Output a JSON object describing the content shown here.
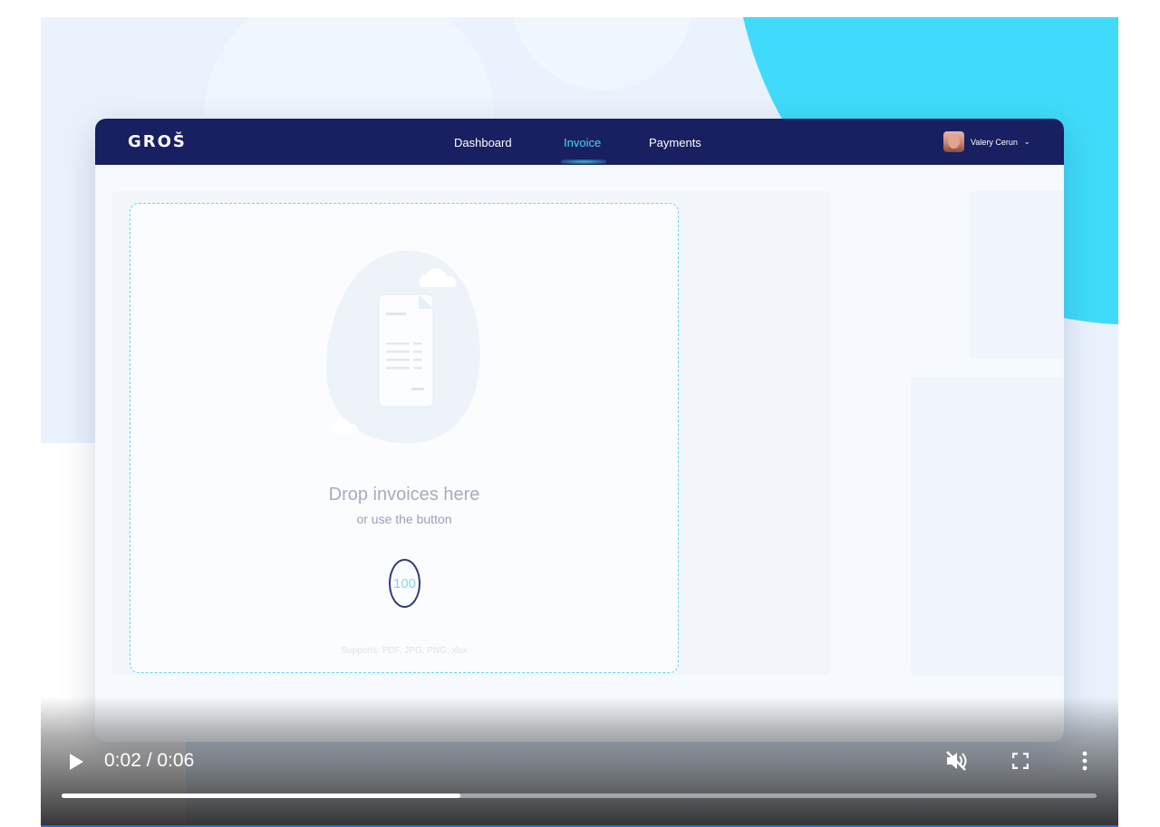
{
  "app": {
    "logo": "GROŠ",
    "nav": [
      "Dashboard",
      "Invoice",
      "Payments"
    ],
    "active_nav": "Invoice",
    "user_name": "Valery Cerun",
    "user_chevron": "⌄"
  },
  "dropzone": {
    "title": "Drop invoices here",
    "subtitle": "or use the button",
    "badge": "100",
    "supports": "Supports: PDF, JPG, PNG, xlsx"
  },
  "player": {
    "time": "0:02 / 0:06",
    "progress": 0.385,
    "icons": [
      "play-icon",
      "muted-speaker-icon",
      "fullscreen-icon",
      "more-vert-icon"
    ]
  },
  "colors": {
    "nav": "#182061",
    "accent": "#45d6f7",
    "blob": "#40dbfa"
  }
}
